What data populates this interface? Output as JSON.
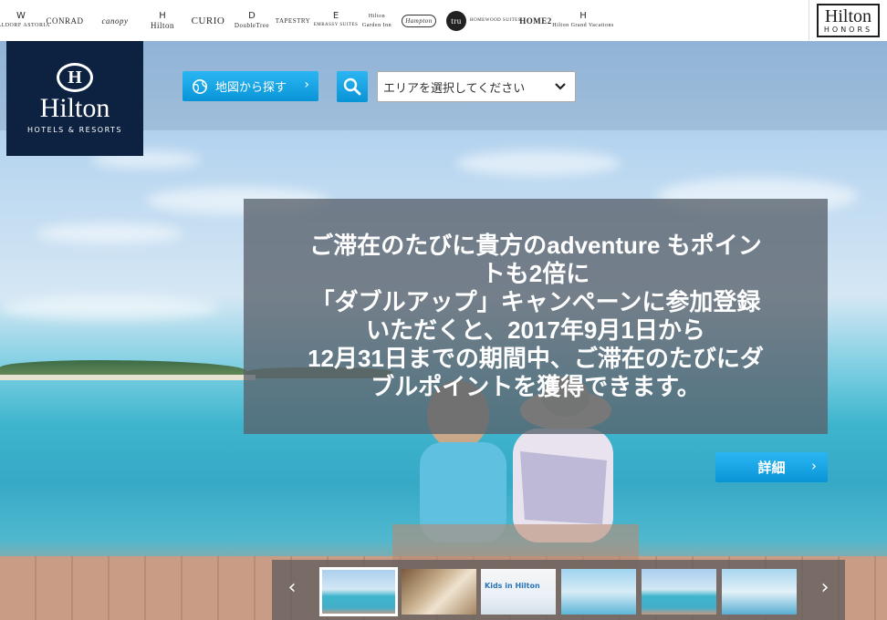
{
  "brands": [
    {
      "name": "WALDORF ASTORIA",
      "mark": "W"
    },
    {
      "name": "CONRAD",
      "mark": ""
    },
    {
      "name": "canopy",
      "mark": ""
    },
    {
      "name": "Hilton",
      "mark": "H"
    },
    {
      "name": "CURIO",
      "mark": ""
    },
    {
      "name": "DoubleTree",
      "mark": "D"
    },
    {
      "name": "TAPESTRY",
      "mark": ""
    },
    {
      "name": "EMBASSY SUITES",
      "mark": "E"
    },
    {
      "name": "Hilton Garden Inn",
      "mark": ""
    },
    {
      "name": "Hampton",
      "mark": ""
    },
    {
      "name": "tru",
      "mark": ""
    },
    {
      "name": "HOMEWOOD SUITES",
      "mark": ""
    },
    {
      "name": "HOME2",
      "mark": ""
    },
    {
      "name": "Hilton Grand Vacations",
      "mark": "H"
    }
  ],
  "honors": {
    "title": "Hilton",
    "subtitle": "HONORS"
  },
  "logo": {
    "mark": "H",
    "word": "Hilton",
    "sub": "HOTELS & RESORTS"
  },
  "search": {
    "map_label": "地図から探す",
    "map_chevron": "›",
    "area_placeholder": "エリアを選択してください",
    "dropdown_chevron": "⌄"
  },
  "hero": {
    "message": "ご滞在のたびに貴方のadventure もポイン\nトも2倍に\n「ダブルアップ」キャンペーンに参加登録\nいただくと、2017年9月1日から\n12月31日までの期間中、ご滞在のたびにダ\nブルポイントを獲得できます。",
    "detail_label": "詳細",
    "detail_chevron": "›"
  },
  "carousel": {
    "prev": "‹",
    "next": "›",
    "active_index": 0,
    "thumbs": [
      {
        "label": ""
      },
      {
        "label": ""
      },
      {
        "label": "Kids in Hilton"
      },
      {
        "label": ""
      },
      {
        "label": ""
      },
      {
        "label": ""
      }
    ]
  },
  "colors": {
    "brand_navy": "#0d2240",
    "button_blue": "#0a94d8"
  }
}
